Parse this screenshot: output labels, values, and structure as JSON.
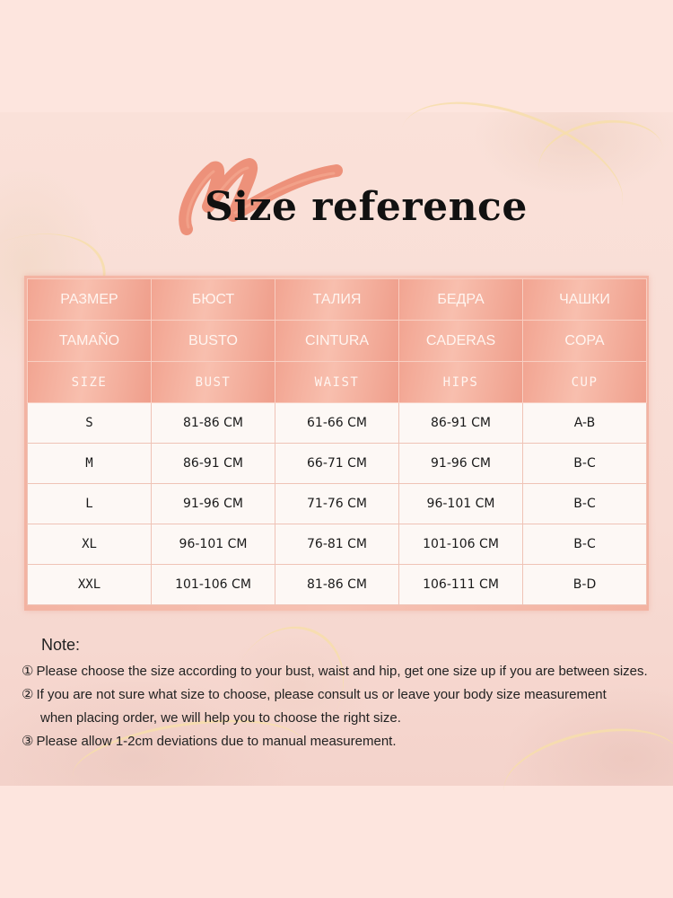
{
  "title": "Size reference",
  "colors": {
    "background": "#fde5de",
    "header_cell": "#f2a592",
    "body_cell": "#fdf8f5",
    "brush_stroke": "#ec8a72",
    "title_text": "#111111"
  },
  "table": {
    "header_rows": [
      [
        "РАЗМЕР",
        "БЮСТ",
        "ТАЛИЯ",
        "БЕДРА",
        "ЧАШКИ"
      ],
      [
        "TAMAÑO",
        "BUSTO",
        "CINTURA",
        "CADERAS",
        "COPA"
      ],
      [
        "SIZE",
        "BUST",
        "WAIST",
        "HIPS",
        "CUP"
      ]
    ],
    "rows": [
      [
        "S",
        "81-86 CM",
        "61-66 CM",
        "86-91 CM",
        "A-B"
      ],
      [
        "M",
        "86-91 CM",
        "66-71 CM",
        "91-96 CM",
        "B-C"
      ],
      [
        "L",
        "91-96 CM",
        "71-76 CM",
        "96-101 CM",
        "B-C"
      ],
      [
        "XL",
        "96-101 CM",
        "76-81 CM",
        "101-106 CM",
        "B-C"
      ],
      [
        "XXL",
        "101-106 CM",
        "81-86 CM",
        "106-111 CM",
        "B-D"
      ]
    ]
  },
  "note": {
    "title": "Note:",
    "items": [
      {
        "num": "①",
        "lines": [
          "Please choose the size according to your bust, waist and hip, get one size up if you are between sizes."
        ]
      },
      {
        "num": "②",
        "lines": [
          "If you are not sure what size to choose, please consult us or leave your body size measurement",
          "when placing order, we will help you to choose the right size."
        ]
      },
      {
        "num": "③",
        "lines": [
          "Please allow 1-2cm deviations due to manual measurement."
        ]
      }
    ]
  }
}
